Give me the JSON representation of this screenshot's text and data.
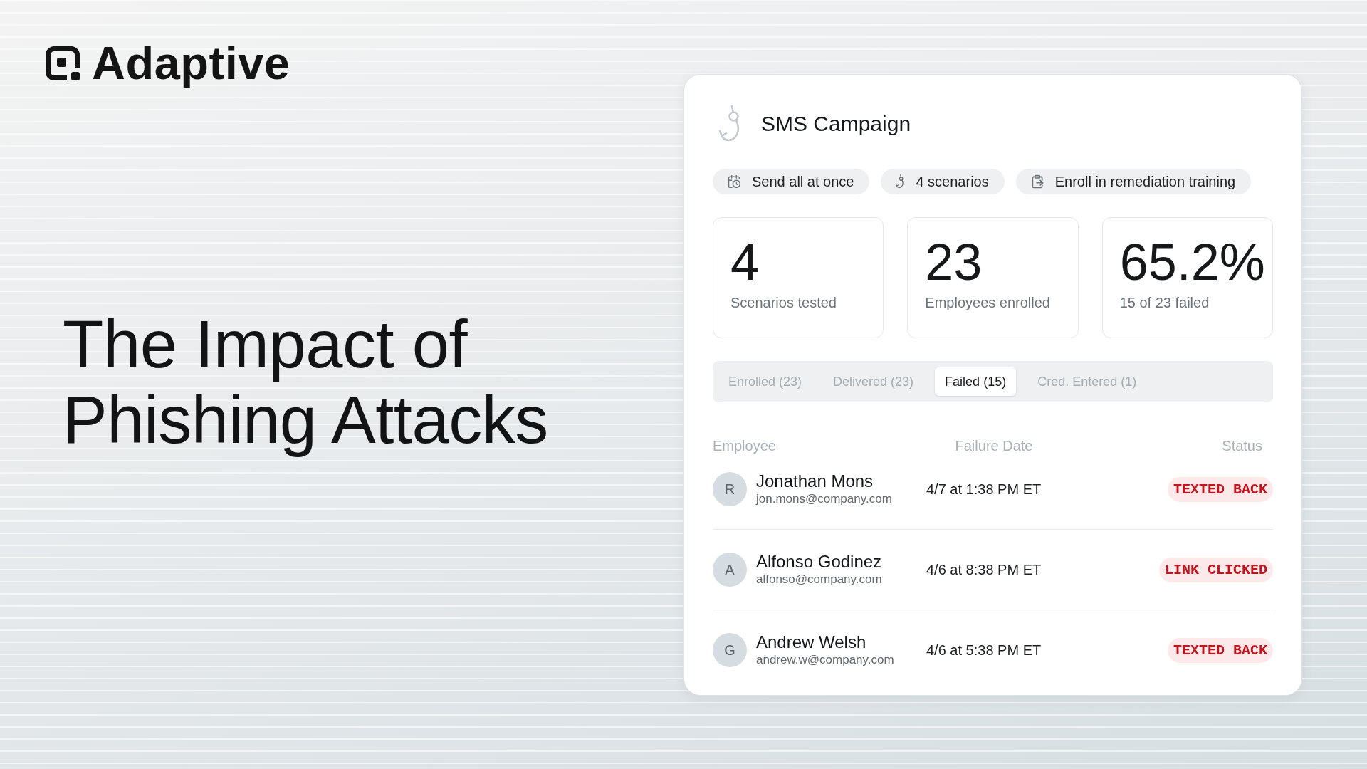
{
  "logo": {
    "name": "Adaptive"
  },
  "headline": {
    "lines": [
      "The Impact of",
      "Phishing Attacks"
    ]
  },
  "campaign": {
    "title": "SMS Campaign",
    "chips": [
      {
        "kind": "schedule",
        "label": "Send all at once"
      },
      {
        "kind": "hook",
        "label": "4 scenarios"
      },
      {
        "kind": "training",
        "label": "Enroll in remediation training"
      }
    ]
  },
  "stats": [
    {
      "value": "4",
      "label": "Scenarios tested"
    },
    {
      "value": "23",
      "label": "Employees enrolled"
    },
    {
      "value": "65.2%",
      "label": "15 of 23 failed"
    }
  ],
  "tabs": [
    {
      "label": "Enrolled (23)",
      "selected": false
    },
    {
      "label": "Delivered (23)",
      "selected": false
    },
    {
      "label": "Failed (15)",
      "selected": true
    },
    {
      "label": "Cred. Entered (1)",
      "selected": false
    }
  ],
  "table": {
    "columns": [
      "Employee",
      "Failure Date",
      "Status"
    ],
    "rows": [
      {
        "initial": "R",
        "name": "Jonathan Mons",
        "email": "jon.mons@company.com",
        "date": "4/7 at 1:38 PM ET",
        "status": "TEXTED BACK"
      },
      {
        "initial": "A",
        "name": "Alfonso Godinez",
        "email": "alfonso@company.com",
        "date": "4/6 at 8:38 PM ET",
        "status": "LINK CLICKED"
      },
      {
        "initial": "G",
        "name": "Andrew Welsh",
        "email": "andrew.w@company.com",
        "date": "4/6 at 5:38 PM ET",
        "status": "TEXTED BACK"
      }
    ]
  }
}
